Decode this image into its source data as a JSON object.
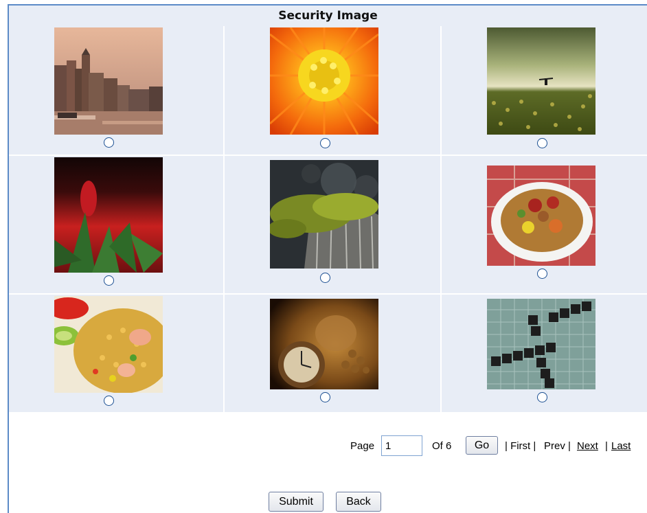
{
  "header": {
    "title": "Security Image"
  },
  "images": [
    {
      "label": "canal-city-sunset-image",
      "selected": false
    },
    {
      "label": "orange-flower-image",
      "selected": false
    },
    {
      "label": "field-person-image",
      "selected": false
    },
    {
      "label": "red-bud-image",
      "selected": false
    },
    {
      "label": "moss-wood-image",
      "selected": false
    },
    {
      "label": "noodle-plate-image",
      "selected": false
    },
    {
      "label": "fried-rice-image",
      "selected": false
    },
    {
      "label": "pocket-watch-image",
      "selected": false
    },
    {
      "label": "scrabble-business-image",
      "selected": false
    }
  ],
  "pager": {
    "page_label": "Page",
    "current_page": "1",
    "of_label": "Of 6",
    "go_label": "Go",
    "first_label": "| First |",
    "prev_label": "Prev |",
    "next_label": "Next",
    "sep": "|",
    "last_label": "Last"
  },
  "actions": {
    "submit_label": "Submit",
    "back_label": "Back"
  }
}
